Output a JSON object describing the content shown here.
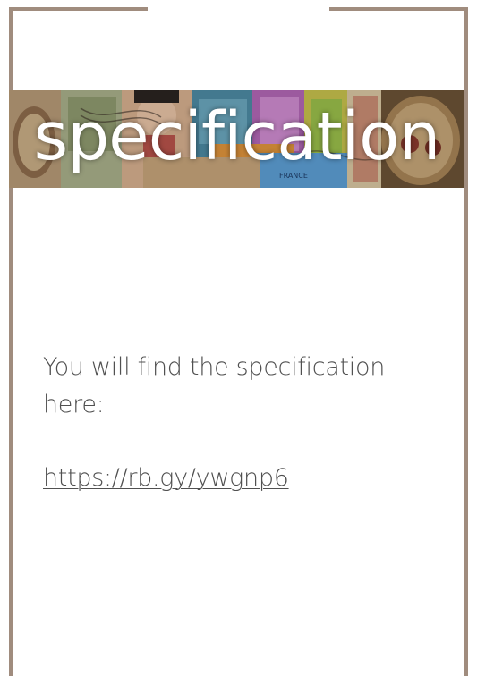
{
  "banner": {
    "title": "specification",
    "stamp_label": "FRANCE"
  },
  "content": {
    "intro": "You will find the specification here:",
    "link_text": "https://rb.gy/ywgnp6"
  },
  "colors": {
    "frame": "#a08c7e",
    "text": "#505050",
    "background": "#ffffff"
  }
}
